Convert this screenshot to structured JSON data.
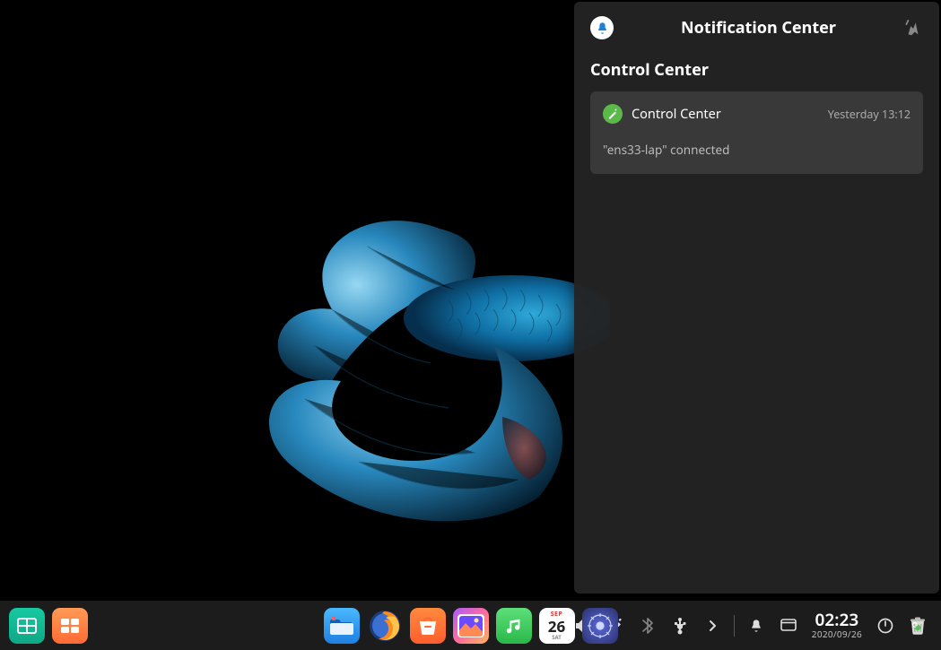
{
  "notification_center": {
    "title": "Notification Center",
    "section_title": "Control Center",
    "card": {
      "title": "Control Center",
      "time": "Yesterday  13:12",
      "body": "\"ens33-lap\" connected"
    }
  },
  "clock": {
    "time": "02:23",
    "date": "2020/09/26"
  },
  "calendar_icon": {
    "month": "SEP",
    "day": "26",
    "weekday": "SAT"
  },
  "dock_left": {
    "multitask": "multitask-view",
    "show_desktop": "show-desktop"
  },
  "dock_apps": {
    "files": "file-manager",
    "firefox": "firefox",
    "app_store": "app-store",
    "gallery": "image-viewer",
    "music": "music",
    "calendar": "calendar",
    "control_center": "control-center"
  },
  "tray": {
    "keyboard": "on-screen-keyboard",
    "volume": "volume",
    "network": "network",
    "bluetooth": "bluetooth",
    "usb": "usb-devices",
    "expand": "tray-expand",
    "notifications": "notifications",
    "desktop_toggle": "desktop-toggle",
    "power": "power-menu",
    "trash": "trash"
  }
}
